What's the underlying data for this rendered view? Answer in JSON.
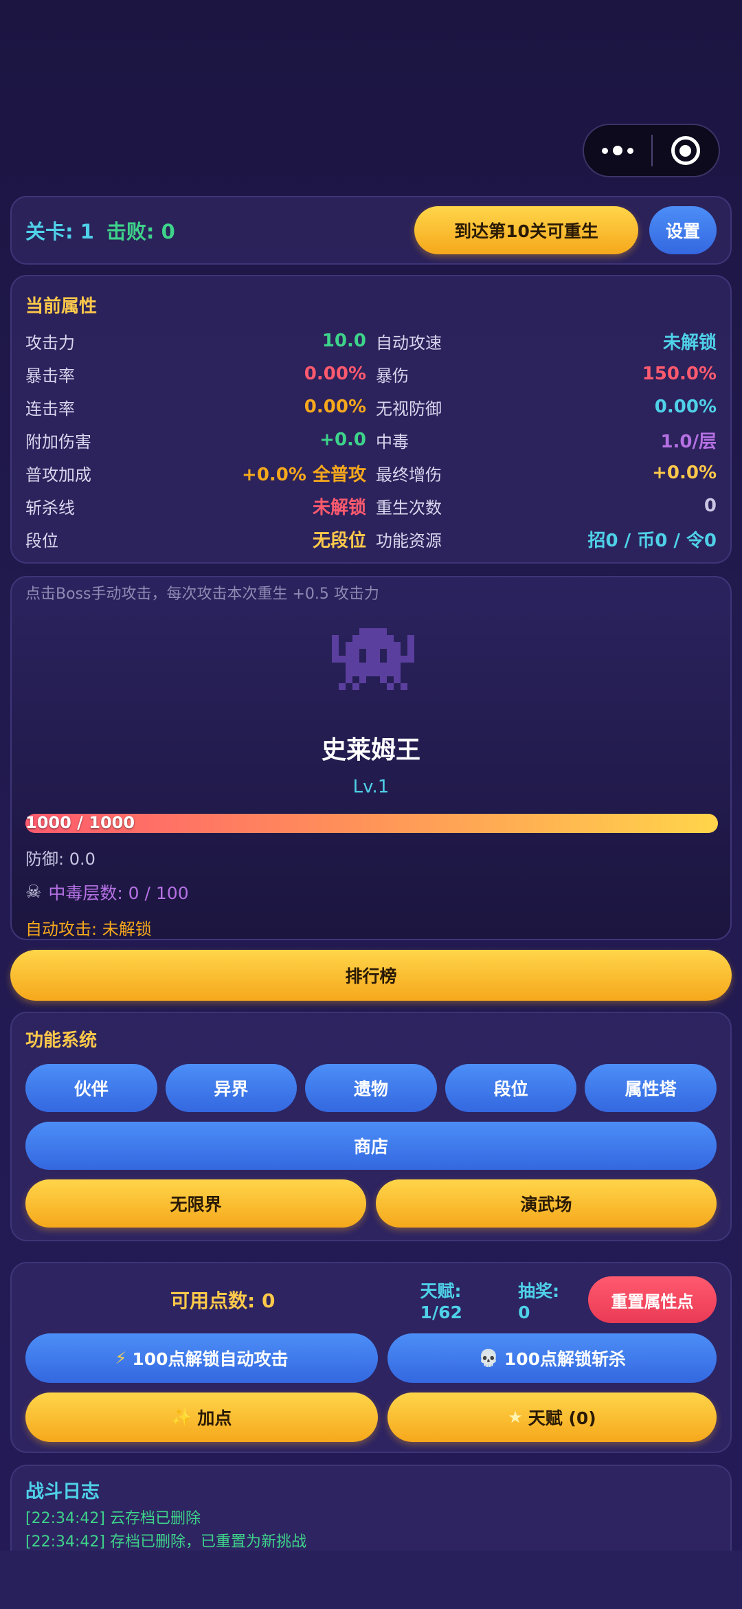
{
  "topbar": {
    "level_label": "关卡: 1",
    "kills_label": "击败: 0",
    "rebirth_button": "到达第10关可重生",
    "settings_button": "设置"
  },
  "stats": {
    "title": "当前属性",
    "left": [
      {
        "label": "攻击力",
        "value": "10.0",
        "color": "#3ed38a"
      },
      {
        "label": "暴击率",
        "value": "0.00%",
        "color": "#ff5a6e"
      },
      {
        "label": "连击率",
        "value": "0.00%",
        "color": "#f6a81c"
      },
      {
        "label": "附加伤害",
        "value": "+0.0",
        "color": "#3ed38a"
      },
      {
        "label": "普攻加成",
        "value": "+0.0% 全普攻",
        "color": "#f6a81c"
      },
      {
        "label": "斩杀线",
        "value": "未解锁",
        "color": "#ff5a6e"
      },
      {
        "label": "段位",
        "value": "无段位",
        "color": "#ffc94a"
      }
    ],
    "right": [
      {
        "label": "自动攻速",
        "value": "未解锁",
        "color": "#4fd1e8"
      },
      {
        "label": "暴伤",
        "value": "150.0%",
        "color": "#ff5a6e"
      },
      {
        "label": "无视防御",
        "value": "0.00%",
        "color": "#4fd1e8"
      },
      {
        "label": "中毒",
        "value": "1.0/层",
        "color": "#b571e3"
      },
      {
        "label": "最终增伤",
        "value": "+0.0%",
        "color": "#ffc94a"
      },
      {
        "label": "重生次数",
        "value": "0",
        "color": "#c9c5e3"
      },
      {
        "label": "功能资源",
        "value": "招0 / 币0 / 令0",
        "color": "#4fd1e8"
      }
    ]
  },
  "boss": {
    "hint": "点击Boss手动攻击，每次攻击本次重生 +0.5 攻击力",
    "name": "史莱姆王",
    "level": "Lv.1",
    "hp_text": "1000 / 1000",
    "hp_fraction": 1.0,
    "defense": "防御: 0.0",
    "poison_icon": "skull-crossbones-icon",
    "poison": "中毒层数: 0 / 100",
    "auto_attack": "自动攻击: 未解锁"
  },
  "leaderboard_button": "排行榜",
  "functions": {
    "title": "功能系统",
    "row1": [
      "伙伴",
      "异界",
      "遗物",
      "段位",
      "属性塔"
    ],
    "shop": "商店",
    "row3": [
      "无限界",
      "演武场"
    ]
  },
  "points": {
    "available": "可用点数: 0",
    "talent": "天赋: 1/62",
    "lottery": "抽奖: 0",
    "reset_button": "重置属性点",
    "unlock_auto": "100点解锁自动攻击",
    "unlock_execute": "100点解锁斩杀",
    "add_points": "加点",
    "talent_button": "天赋 (0)"
  },
  "log": {
    "title": "战斗日志",
    "lines": [
      "[22:34:42] 云存档已删除",
      "[22:34:42] 存档已删除，已重置为新挑战"
    ]
  }
}
